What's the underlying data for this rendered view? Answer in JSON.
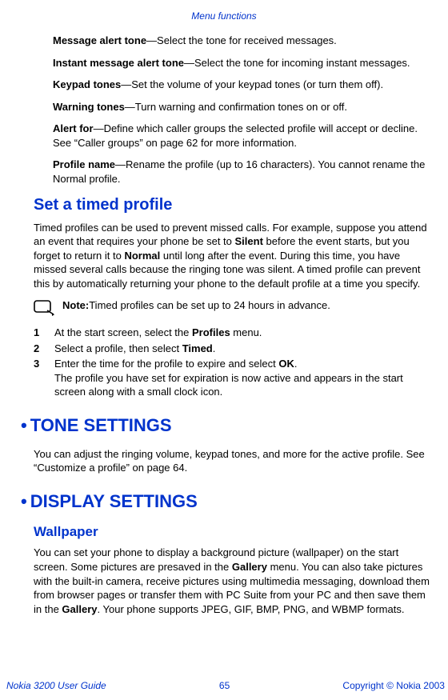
{
  "header": {
    "title": "Menu functions"
  },
  "items": {
    "msg_alert": {
      "term": "Message alert tone",
      "desc": "—Select the tone for received messages."
    },
    "im_alert": {
      "term": "Instant message alert tone",
      "desc": "—Select the tone for incoming instant messages."
    },
    "keypad": {
      "term": "Keypad tones",
      "desc": "—Set the volume of your keypad tones (or turn them off)."
    },
    "warning": {
      "term": "Warning tones",
      "desc": "—Turn warning and confirmation tones on or off."
    },
    "alert_for": {
      "term": "Alert for",
      "desc": "—Define which caller groups the selected profile will accept or decline. See “Caller groups” on page 62 for more information."
    },
    "profile_name": {
      "term": "Profile name",
      "desc": "—Rename the profile (up to 16 characters). You cannot rename the Normal profile."
    }
  },
  "timed": {
    "heading": "Set a timed profile",
    "para_pre": "Timed profiles can be used to prevent missed calls. For example, suppose you attend an event that requires your phone be set to ",
    "para_bold1": "Silent",
    "para_mid": " before the event starts, but you forget to return it to ",
    "para_bold2": "Normal",
    "para_post": " until long after the event. During this time, you have missed several calls because the ringing tone was silent. A timed profile can prevent this by automatically returning your phone to the default profile at a time you specify.",
    "note_label": "Note:",
    "note_text": "Timed profiles can be set up to 24 hours in advance.",
    "steps": {
      "s1_num": "1",
      "s1_a": "At the start screen, select the ",
      "s1_b": "Profiles",
      "s1_c": " menu.",
      "s2_num": "2",
      "s2_a": "Select a profile, then select ",
      "s2_b": "Timed",
      "s2_c": ".",
      "s3_num": "3",
      "s3_a": "Enter the time for the profile to expire and select ",
      "s3_b": "OK",
      "s3_c": ".",
      "s3_followup": "The profile you have set for expiration is now active and appears in the start screen along with a small clock icon."
    }
  },
  "tone": {
    "heading": "TONE SETTINGS",
    "para": "You can adjust the ringing volume, keypad tones, and more for the active profile. See “Customize a profile” on page 64."
  },
  "display": {
    "heading": "DISPLAY SETTINGS",
    "sub": "Wallpaper",
    "para_a": "You can set your phone to display a background picture (wallpaper) on the start screen. Some pictures are presaved in the ",
    "para_b": "Gallery",
    "para_c": " menu. You can also take pictures with the built-in camera, receive pictures using multimedia messaging, download them from browser pages or transfer them with PC Suite from your PC and then save them in the ",
    "para_d": "Gallery",
    "para_e": ". Your phone supports JPEG, GIF, BMP, PNG, and WBMP formats."
  },
  "footer": {
    "left": "Nokia 3200 User Guide",
    "center": "65",
    "right": "Copyright © Nokia 2003"
  },
  "bullet": "•"
}
